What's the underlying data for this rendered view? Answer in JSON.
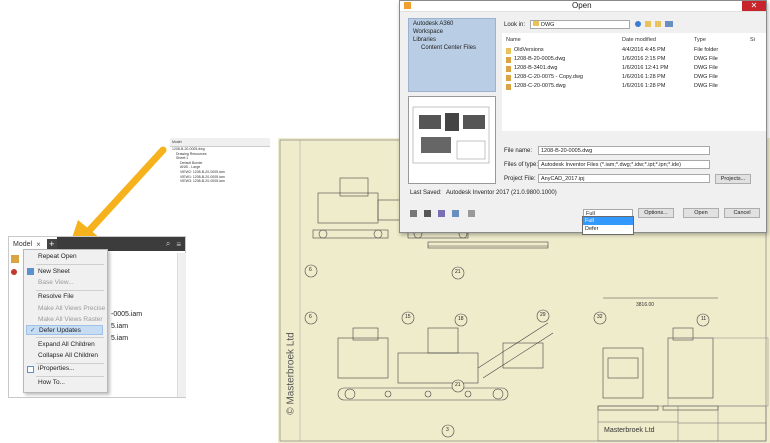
{
  "small_browser": {
    "tab": "Model",
    "items": [
      "1208-B-20-0005.dwg",
      "Drawing Resources",
      "Sheet:1",
      "Default Border",
      "ANSI - Large",
      "VIEW2: 1208-B-20-0005.iam",
      "VIEW1: 1208-B-20-0005.iam",
      "VIEW3: 1208-B-20-0005.iam"
    ]
  },
  "browser": {
    "tab_label": "Model",
    "close_glyph": "×",
    "add_glyph": "+",
    "search_glyph": "⌕",
    "menu_glyph": "≡",
    "rows": [
      "-0005.iam",
      "5.iam",
      "5.iam"
    ]
  },
  "context_menu": {
    "items": [
      {
        "label": "Repeat Open",
        "disabled": false
      },
      {
        "label": "New Sheet",
        "disabled": false
      },
      {
        "label": "Base View...",
        "disabled": true
      },
      {
        "label": "Resolve File",
        "disabled": false
      },
      {
        "label": "Make All Views Precise",
        "disabled": true
      },
      {
        "label": "Make All Views Raster",
        "disabled": true
      },
      {
        "label": "Defer Updates",
        "disabled": false,
        "checked": true
      },
      {
        "label": "Expand All Children",
        "disabled": false
      },
      {
        "label": "Collapse All Children",
        "disabled": false
      },
      {
        "label": "iProperties...",
        "disabled": false
      },
      {
        "label": "How To...",
        "disabled": false
      }
    ]
  },
  "dialog": {
    "title": "Open",
    "close_glyph": "✕",
    "places": [
      "Autodesk A360",
      "Workspace",
      "Libraries",
      "Content Center Files"
    ],
    "look_in_label": "Look in:",
    "look_in_value": "DWG",
    "columns": [
      "Name",
      "Date modified",
      "Type",
      "Si"
    ],
    "files": [
      {
        "name": "OldVersions",
        "date": "4/4/2016 4:45 PM",
        "type": "File folder",
        "folder": true
      },
      {
        "name": "1208-B-20-0005.dwg",
        "date": "1/6/2016 2:15 PM",
        "type": "DWG File",
        "folder": false
      },
      {
        "name": "1208-B-3401.dwg",
        "date": "1/6/2016 12:41 PM",
        "type": "DWG File",
        "folder": false
      },
      {
        "name": "1208-C-20-0075 - Copy.dwg",
        "date": "1/6/2016 1:28 PM",
        "type": "DWG File",
        "folder": false
      },
      {
        "name": "1208-C-20-0075.dwg",
        "date": "1/6/2016 1:28 PM",
        "type": "DWG File",
        "folder": false
      }
    ],
    "file_name_label": "File name:",
    "file_name_value": "1208-B-20-0005.dwg",
    "files_of_type_label": "Files of type:",
    "files_of_type_value": "Autodesk Inventor Files (*.iam;*.dwg;*.idw;*.ipt;*.ipn;*.ide)",
    "project_file_label": "Project File:",
    "project_file_value": "AnyCAD_2017.ipj",
    "projects_button": "Projects...",
    "last_saved_label": "Last Saved:",
    "last_saved_value": "Autodesk Inventor 2017 (21.0.9800.1000)",
    "mode_value": "Full",
    "mode_options": [
      "Full",
      "Defer"
    ],
    "options_button": "Options...",
    "open_button": "Open",
    "cancel_button": "Cancel"
  },
  "drawing": {
    "company_side": "© Masterbroek Ltd",
    "company_block": "Masterbroek Ltd",
    "dimension": "3816.00",
    "balloons": [
      "6",
      "21",
      "6",
      "15",
      "18",
      "29",
      "21",
      "32",
      "11",
      "3"
    ]
  },
  "colors": {
    "sheet": "#efeccc",
    "arrow": "#f5b21c",
    "menu_highlight": "#c5dcf3",
    "dialog_places": "#b9cde4",
    "close_red": "#c7242c"
  }
}
